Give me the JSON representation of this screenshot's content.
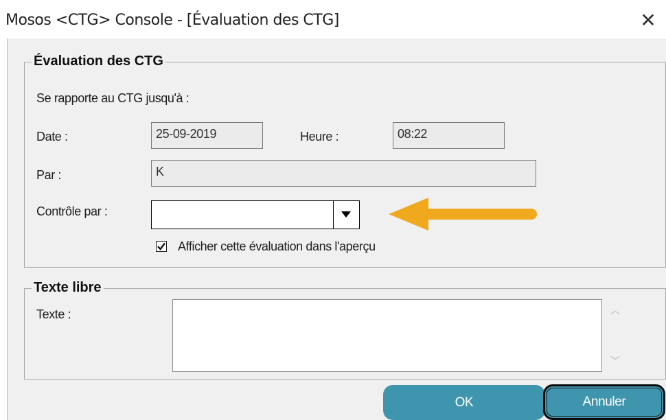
{
  "window": {
    "title": "Mosos <CTG> Console - [Évaluation des CTG]",
    "close_glyph": "✕"
  },
  "evaluation": {
    "group_title": "Évaluation des CTG",
    "intro": "Se rapporte au CTG jusqu'à :",
    "date_label": "Date :",
    "date_value": "25-09-2019",
    "heure_label": "Heure :",
    "heure_value": "08:22",
    "par_label": "Par :",
    "par_value": "K",
    "controle_label": "Contrôle par :",
    "controle_value": "",
    "checkbox_label": "Afficher cette évaluation dans l'aperçu",
    "checkbox_checked": true
  },
  "free_text": {
    "group_title": "Texte libre",
    "texte_label": "Texte :",
    "texte_value": ""
  },
  "buttons": {
    "ok": "OK",
    "cancel": "Annuler"
  },
  "annotation": {
    "arrow_color": "#f0a81e",
    "pointing": "left"
  }
}
